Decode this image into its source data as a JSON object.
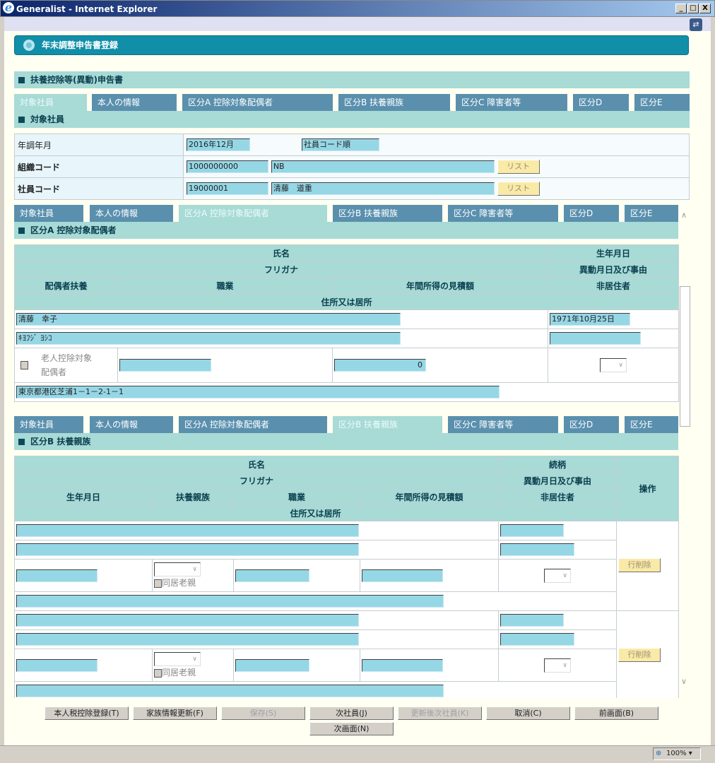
{
  "window": {
    "title": "Generalist - Internet Explorer",
    "minimize": "_",
    "maximize": "□",
    "close": "X"
  },
  "page": {
    "title": "年末調整申告書登録"
  },
  "form_title": "扶養控除等(異動)申告書",
  "tabs": [
    "対象社員",
    "本人の情報",
    "区分A 控除対象配偶者",
    "区分B 扶養親族",
    "区分C 障害者等",
    "区分D",
    "区分E"
  ],
  "target": {
    "heading": "対象社員",
    "year_label": "年調年月",
    "year_value": "2016年12月",
    "sort_value": "社員コード順",
    "org_label": "組織コード",
    "org_code": "1000000000",
    "org_name": "NB",
    "emp_label": "社員コード",
    "emp_code": "19000001",
    "emp_name": "清藤　道重",
    "list_button": "リスト"
  },
  "sectionA": {
    "heading": "区分A 控除対象配偶者",
    "headers": {
      "name": "氏名",
      "birth": "生年月日",
      "kana": "フリガナ",
      "change": "異動月日及び事由",
      "spouse": "配偶者扶養",
      "job": "職業",
      "income": "年間所得の見積額",
      "nonres": "非居住者",
      "address": "住所又は居所"
    },
    "name": "清藤　幸子",
    "birth": "1971年10月25日",
    "kana": "ｷﾖﾌｼﾞ ﾖｼｺ",
    "change": "",
    "elderly_label": "老人控除対象配偶者",
    "job": "",
    "income": "0",
    "address": "東京都港区芝浦1－1－2-1－1"
  },
  "sectionB": {
    "heading": "区分B 扶養親族",
    "headers": {
      "name": "氏名",
      "relation": "続柄",
      "kana": "フリガナ",
      "change": "異動月日及び事由",
      "birth": "生年月日",
      "dependent": "扶養親族",
      "job": "職業",
      "income": "年間所得の見積額",
      "nonres": "非居住者",
      "address": "住所又は居所",
      "op": "操作"
    },
    "cohabit_label": "同居老親",
    "delete_button": "行削除"
  },
  "buttons": [
    "本人税控除登録(T)",
    "家族情報更新(F)",
    "保存(S)",
    "次社員(J)",
    "更新後次社員(K)",
    "取消(C)",
    "前画面(B)",
    "次画面(N)"
  ],
  "status": {
    "zoom": "100%"
  }
}
